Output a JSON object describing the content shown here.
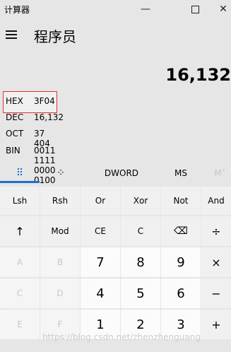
{
  "window": {
    "title": "计算器",
    "minimize_glyph": "—",
    "close_glyph": "✕"
  },
  "header": {
    "mode_title": "程序员"
  },
  "display": {
    "value": "16,132"
  },
  "bases": [
    {
      "key": "HEX",
      "value": "3F04"
    },
    {
      "key": "DEC",
      "value": "16,132"
    },
    {
      "key": "OCT",
      "value": "37 404"
    },
    {
      "key": "BIN",
      "value": "0011 1111 0000 0100"
    }
  ],
  "tabs": {
    "keypad_icon": "⠿",
    "bit_icon": "⁘",
    "word_size": "DWORD",
    "memory_store": "MS",
    "memory_menu": "M˅"
  },
  "keys": {
    "row1": [
      "Lsh",
      "Rsh",
      "Or",
      "Xor",
      "Not",
      "And"
    ],
    "row2": [
      "↑",
      "Mod",
      "CE",
      "C",
      "⌫",
      "÷"
    ],
    "row3": [
      "A",
      "B",
      "7",
      "8",
      "9",
      "×"
    ],
    "row4": [
      "C",
      "D",
      "4",
      "5",
      "6",
      "−"
    ],
    "row5": [
      "E",
      "F",
      "1",
      "2",
      "3",
      "+"
    ]
  },
  "watermark": "https://blog.csdn.net/zhenzhenguang",
  "colors": {
    "accent": "#1e6fd0",
    "highlight_border": "#e0302f"
  }
}
